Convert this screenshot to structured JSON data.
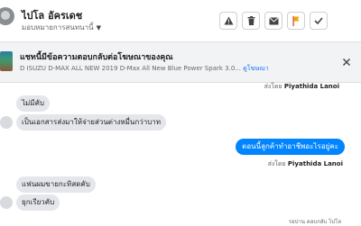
{
  "header": {
    "name": "ไปโล อัครเดช",
    "subtitle": "มอบหมายการสนทนานี้",
    "tools": [
      {
        "icon": "warning-icon"
      },
      {
        "icon": "trash-icon"
      },
      {
        "icon": "envelope-icon"
      },
      {
        "icon": "flag-icon"
      },
      {
        "icon": "check-icon"
      }
    ]
  },
  "ad": {
    "title": "แชทนี้มีข้อความตอบกลับต่อโฆษณาของคุณ",
    "description": "D ISUZU D-MAX ALL NEW 2019 D-Max All New Blue Power Spark 3.0...",
    "link": "ดูโฆษณา"
  },
  "conversation": {
    "sent_by_prefix": "ส่งโดย",
    "agent_name": "Piyathida Lanoi",
    "messages": [
      {
        "side": "in",
        "text": "ไม่มีคับ"
      },
      {
        "side": "in",
        "text": "เป็นเอกสารส่งมาให้จ่ายส่วนต่างหมื่นกว่าบาท"
      },
      {
        "side": "out",
        "text": "ตอนนี้ลูกค้าทำอาชีพอะไรอยู่คะ"
      },
      {
        "side": "in",
        "text": "แฟนผมขายกะทิสดคับ"
      },
      {
        "side": "in",
        "text": "ยุกเรียวคับ"
      }
    ],
    "bottom_note": "รอบ่าน ตอบกลับ ไปโล"
  }
}
